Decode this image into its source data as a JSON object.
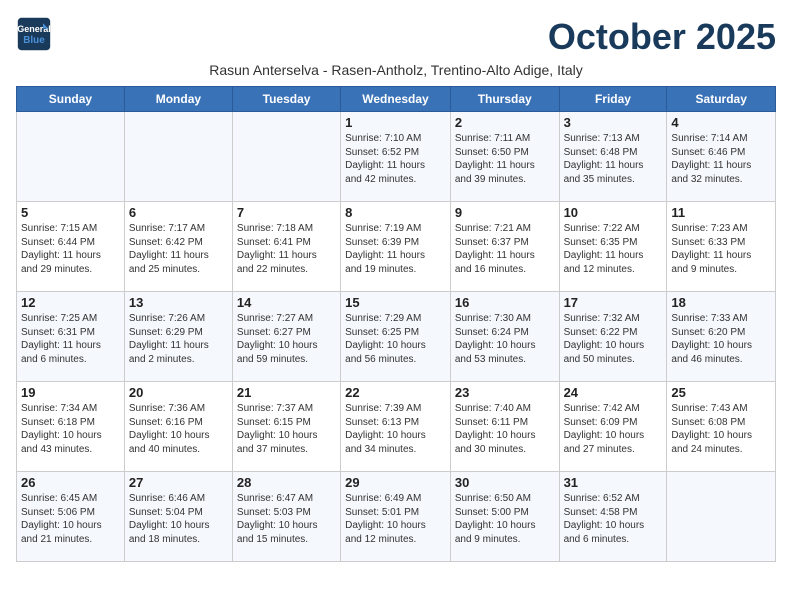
{
  "header": {
    "logo_line1": "General",
    "logo_line2": "Blue",
    "month_title": "October 2025",
    "subtitle": "Rasun Anterselva - Rasen-Antholz, Trentino-Alto Adige, Italy"
  },
  "days_of_week": [
    "Sunday",
    "Monday",
    "Tuesday",
    "Wednesday",
    "Thursday",
    "Friday",
    "Saturday"
  ],
  "weeks": [
    [
      {
        "date": "",
        "info": ""
      },
      {
        "date": "",
        "info": ""
      },
      {
        "date": "",
        "info": ""
      },
      {
        "date": "1",
        "info": "Sunrise: 7:10 AM\nSunset: 6:52 PM\nDaylight: 11 hours\nand 42 minutes."
      },
      {
        "date": "2",
        "info": "Sunrise: 7:11 AM\nSunset: 6:50 PM\nDaylight: 11 hours\nand 39 minutes."
      },
      {
        "date": "3",
        "info": "Sunrise: 7:13 AM\nSunset: 6:48 PM\nDaylight: 11 hours\nand 35 minutes."
      },
      {
        "date": "4",
        "info": "Sunrise: 7:14 AM\nSunset: 6:46 PM\nDaylight: 11 hours\nand 32 minutes."
      }
    ],
    [
      {
        "date": "5",
        "info": "Sunrise: 7:15 AM\nSunset: 6:44 PM\nDaylight: 11 hours\nand 29 minutes."
      },
      {
        "date": "6",
        "info": "Sunrise: 7:17 AM\nSunset: 6:42 PM\nDaylight: 11 hours\nand 25 minutes."
      },
      {
        "date": "7",
        "info": "Sunrise: 7:18 AM\nSunset: 6:41 PM\nDaylight: 11 hours\nand 22 minutes."
      },
      {
        "date": "8",
        "info": "Sunrise: 7:19 AM\nSunset: 6:39 PM\nDaylight: 11 hours\nand 19 minutes."
      },
      {
        "date": "9",
        "info": "Sunrise: 7:21 AM\nSunset: 6:37 PM\nDaylight: 11 hours\nand 16 minutes."
      },
      {
        "date": "10",
        "info": "Sunrise: 7:22 AM\nSunset: 6:35 PM\nDaylight: 11 hours\nand 12 minutes."
      },
      {
        "date": "11",
        "info": "Sunrise: 7:23 AM\nSunset: 6:33 PM\nDaylight: 11 hours\nand 9 minutes."
      }
    ],
    [
      {
        "date": "12",
        "info": "Sunrise: 7:25 AM\nSunset: 6:31 PM\nDaylight: 11 hours\nand 6 minutes."
      },
      {
        "date": "13",
        "info": "Sunrise: 7:26 AM\nSunset: 6:29 PM\nDaylight: 11 hours\nand 2 minutes."
      },
      {
        "date": "14",
        "info": "Sunrise: 7:27 AM\nSunset: 6:27 PM\nDaylight: 10 hours\nand 59 minutes."
      },
      {
        "date": "15",
        "info": "Sunrise: 7:29 AM\nSunset: 6:25 PM\nDaylight: 10 hours\nand 56 minutes."
      },
      {
        "date": "16",
        "info": "Sunrise: 7:30 AM\nSunset: 6:24 PM\nDaylight: 10 hours\nand 53 minutes."
      },
      {
        "date": "17",
        "info": "Sunrise: 7:32 AM\nSunset: 6:22 PM\nDaylight: 10 hours\nand 50 minutes."
      },
      {
        "date": "18",
        "info": "Sunrise: 7:33 AM\nSunset: 6:20 PM\nDaylight: 10 hours\nand 46 minutes."
      }
    ],
    [
      {
        "date": "19",
        "info": "Sunrise: 7:34 AM\nSunset: 6:18 PM\nDaylight: 10 hours\nand 43 minutes."
      },
      {
        "date": "20",
        "info": "Sunrise: 7:36 AM\nSunset: 6:16 PM\nDaylight: 10 hours\nand 40 minutes."
      },
      {
        "date": "21",
        "info": "Sunrise: 7:37 AM\nSunset: 6:15 PM\nDaylight: 10 hours\nand 37 minutes."
      },
      {
        "date": "22",
        "info": "Sunrise: 7:39 AM\nSunset: 6:13 PM\nDaylight: 10 hours\nand 34 minutes."
      },
      {
        "date": "23",
        "info": "Sunrise: 7:40 AM\nSunset: 6:11 PM\nDaylight: 10 hours\nand 30 minutes."
      },
      {
        "date": "24",
        "info": "Sunrise: 7:42 AM\nSunset: 6:09 PM\nDaylight: 10 hours\nand 27 minutes."
      },
      {
        "date": "25",
        "info": "Sunrise: 7:43 AM\nSunset: 6:08 PM\nDaylight: 10 hours\nand 24 minutes."
      }
    ],
    [
      {
        "date": "26",
        "info": "Sunrise: 6:45 AM\nSunset: 5:06 PM\nDaylight: 10 hours\nand 21 minutes."
      },
      {
        "date": "27",
        "info": "Sunrise: 6:46 AM\nSunset: 5:04 PM\nDaylight: 10 hours\nand 18 minutes."
      },
      {
        "date": "28",
        "info": "Sunrise: 6:47 AM\nSunset: 5:03 PM\nDaylight: 10 hours\nand 15 minutes."
      },
      {
        "date": "29",
        "info": "Sunrise: 6:49 AM\nSunset: 5:01 PM\nDaylight: 10 hours\nand 12 minutes."
      },
      {
        "date": "30",
        "info": "Sunrise: 6:50 AM\nSunset: 5:00 PM\nDaylight: 10 hours\nand 9 minutes."
      },
      {
        "date": "31",
        "info": "Sunrise: 6:52 AM\nSunset: 4:58 PM\nDaylight: 10 hours\nand 6 minutes."
      },
      {
        "date": "",
        "info": ""
      }
    ]
  ]
}
